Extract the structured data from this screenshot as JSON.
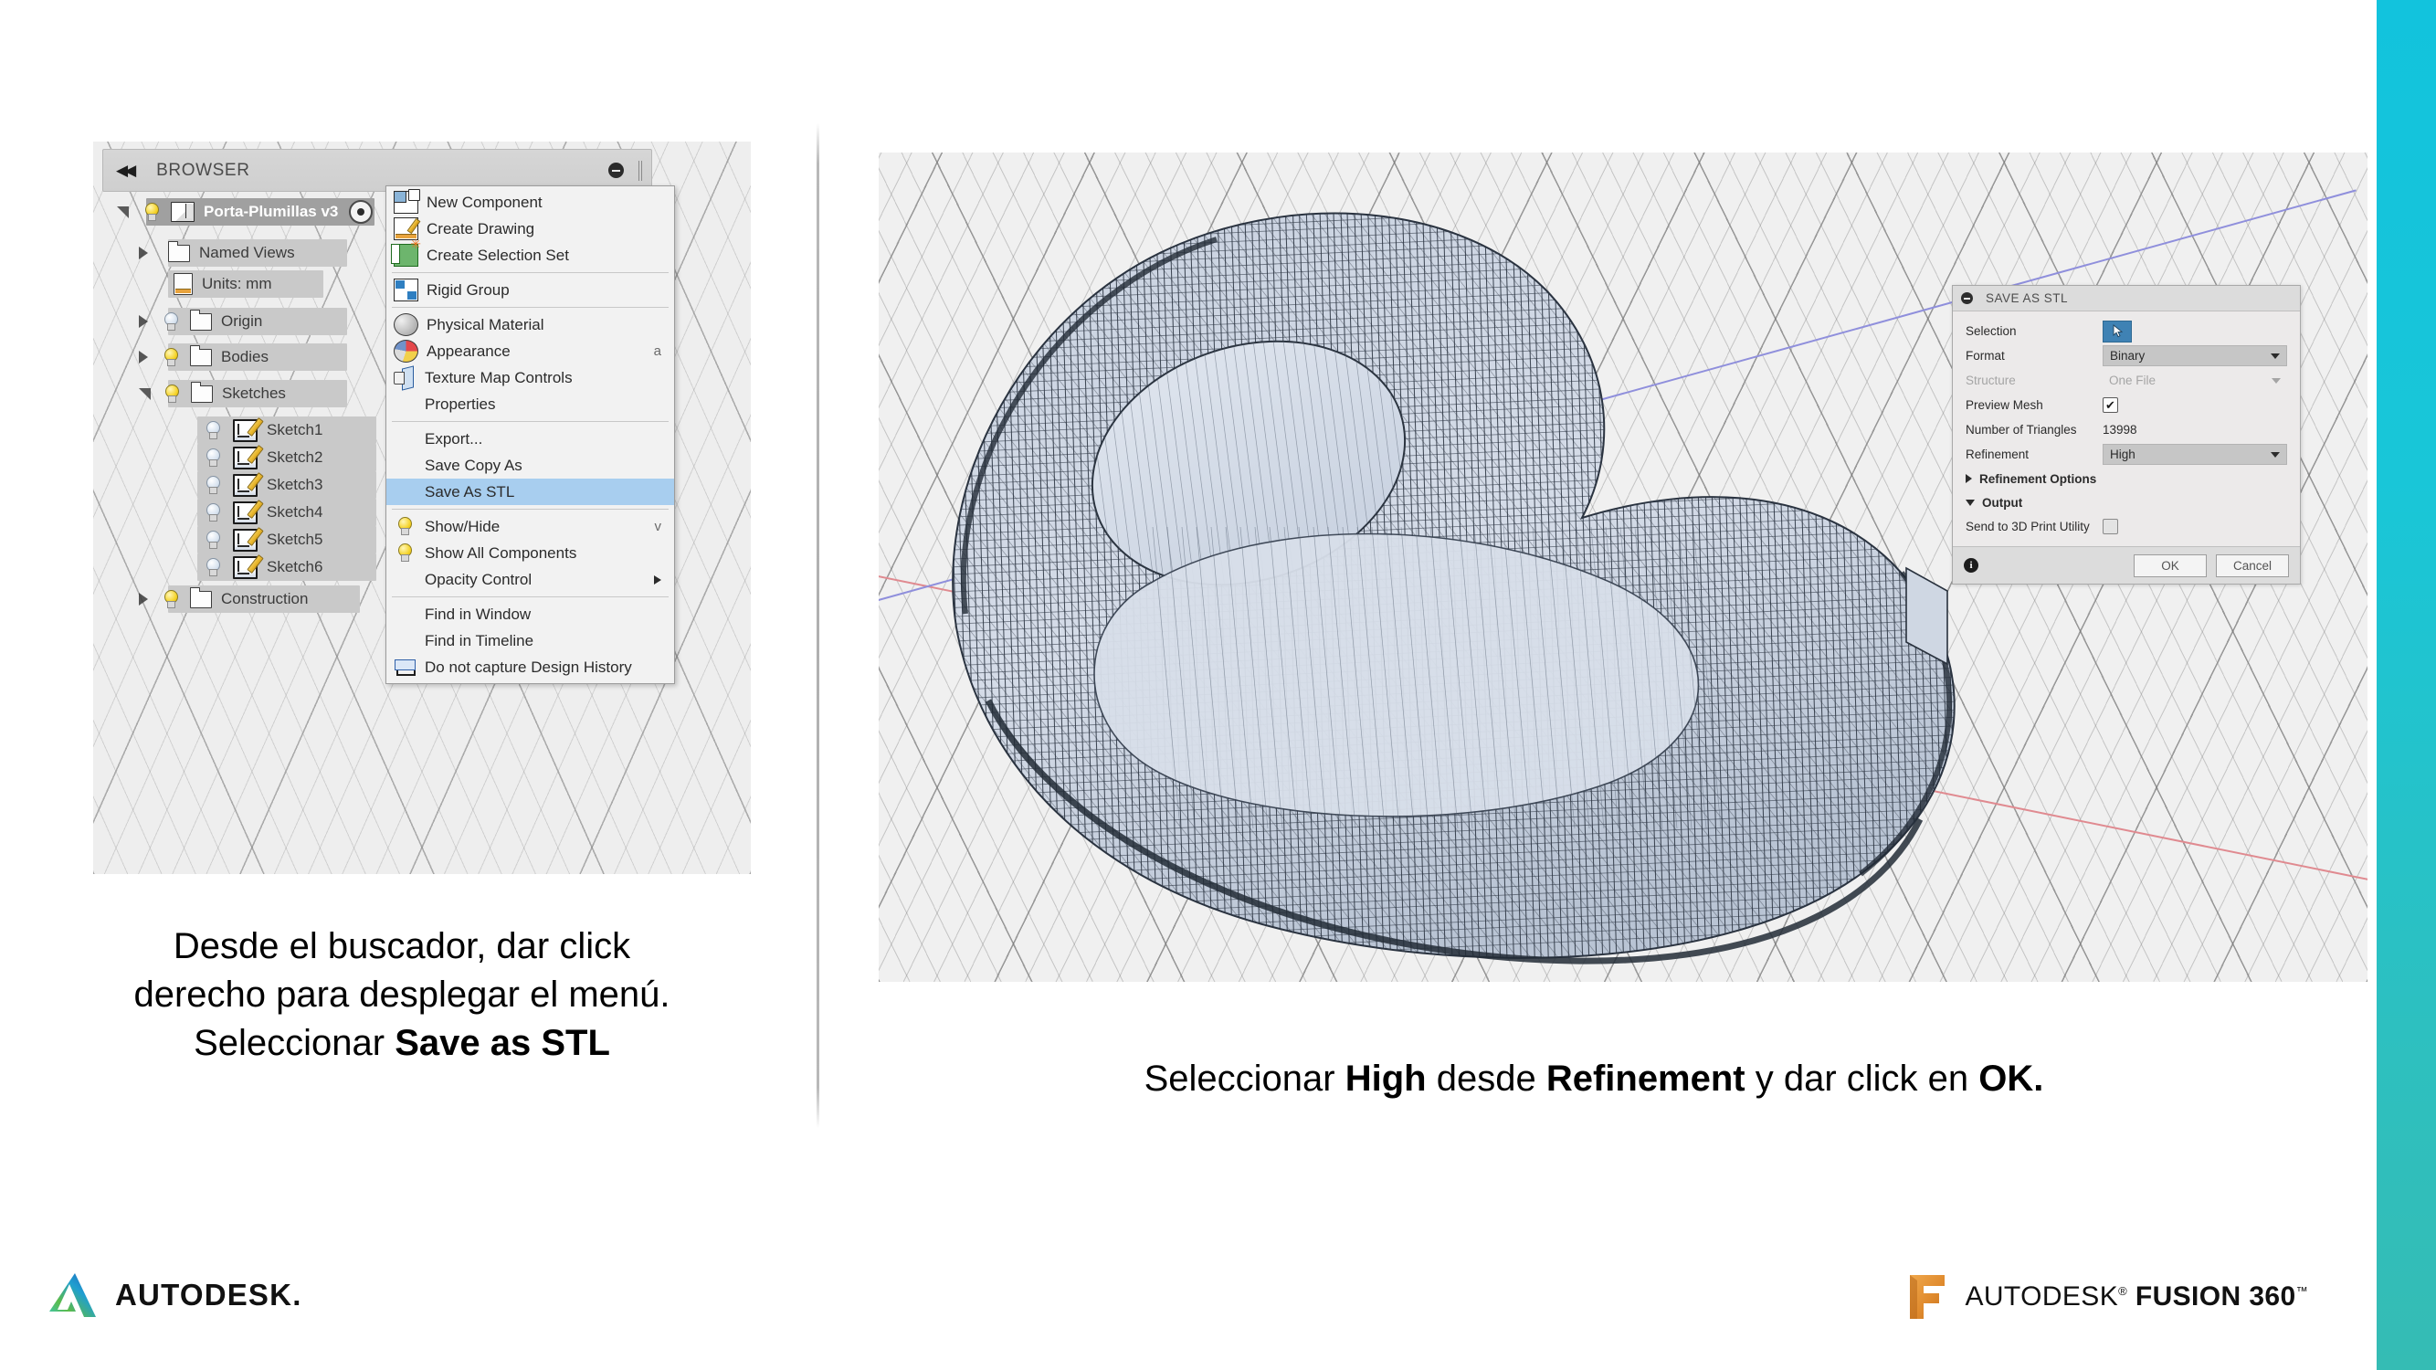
{
  "slide": {
    "accent_color": "#19c6d8"
  },
  "left_screenshot": {
    "browser_panel": {
      "title": "BROWSER",
      "collapse_icon": "double-chevron-left-icon",
      "minimize_icon": "minimize-circle-icon"
    },
    "tree": [
      {
        "label": "Porta-Plumillas v3",
        "icon": "component-cube-icon",
        "selected": true,
        "expanded": true,
        "has_bulb": true,
        "has_eyeball": true
      },
      {
        "label": "Named Views",
        "icon": "folder-icon",
        "expanded": false,
        "has_bulb": false
      },
      {
        "label": "Units: mm",
        "icon": "document-ruler-icon",
        "expanded": null,
        "has_bulb": false
      },
      {
        "label": "Origin",
        "icon": "folder-icon",
        "expanded": false,
        "has_bulb": true,
        "bulb_off": true
      },
      {
        "label": "Bodies",
        "icon": "folder-icon",
        "expanded": false,
        "has_bulb": true
      },
      {
        "label": "Sketches",
        "icon": "folder-icon",
        "expanded": true,
        "has_bulb": true
      },
      {
        "label": "Sketch1",
        "icon": "sketch-icon",
        "has_bulb": true,
        "bulb_off": true,
        "indent": true
      },
      {
        "label": "Sketch2",
        "icon": "sketch-icon",
        "has_bulb": true,
        "bulb_off": true,
        "indent": true
      },
      {
        "label": "Sketch3",
        "icon": "sketch-icon",
        "has_bulb": true,
        "bulb_off": true,
        "indent": true
      },
      {
        "label": "Sketch4",
        "icon": "sketch-icon",
        "has_bulb": true,
        "bulb_off": true,
        "indent": true
      },
      {
        "label": "Sketch5",
        "icon": "sketch-icon",
        "has_bulb": true,
        "bulb_off": true,
        "indent": true
      },
      {
        "label": "Sketch6",
        "icon": "sketch-icon",
        "has_bulb": true,
        "bulb_off": true,
        "indent": true
      },
      {
        "label": "Construction",
        "icon": "folder-icon",
        "expanded": false,
        "has_bulb": true
      }
    ],
    "context_menu": {
      "items": [
        {
          "label": "New Component",
          "icon": "new-component-icon",
          "accel": "",
          "highlighted": false,
          "submenu": false
        },
        {
          "label": "Create Drawing",
          "icon": "create-drawing-icon",
          "accel": "",
          "highlighted": false,
          "submenu": false
        },
        {
          "label": "Create Selection Set",
          "icon": "selection-set-icon",
          "accel": "",
          "highlighted": false,
          "submenu": false
        },
        {
          "separator": true
        },
        {
          "label": "Rigid Group",
          "icon": "rigid-group-icon",
          "accel": "",
          "highlighted": false,
          "submenu": false
        },
        {
          "separator": true
        },
        {
          "label": "Physical Material",
          "icon": "physical-material-icon",
          "accel": "",
          "highlighted": false,
          "submenu": false
        },
        {
          "label": "Appearance",
          "icon": "appearance-icon",
          "accel": "a",
          "highlighted": false,
          "submenu": false
        },
        {
          "label": "Texture Map Controls",
          "icon": "texture-map-icon",
          "accel": "",
          "highlighted": false,
          "submenu": false
        },
        {
          "label": "Properties",
          "icon": "",
          "accel": "",
          "highlighted": false,
          "submenu": false
        },
        {
          "separator": true
        },
        {
          "label": "Export...",
          "icon": "",
          "accel": "",
          "highlighted": false,
          "submenu": false
        },
        {
          "label": "Save Copy As",
          "icon": "",
          "accel": "",
          "highlighted": false,
          "submenu": false
        },
        {
          "label": "Save As STL",
          "icon": "",
          "accel": "",
          "highlighted": true,
          "submenu": false
        },
        {
          "separator": true
        },
        {
          "label": "Show/Hide",
          "icon": "lightbulb-icon",
          "accel": "v",
          "highlighted": false,
          "submenu": false
        },
        {
          "label": "Show All Components",
          "icon": "lightbulb-icon",
          "accel": "",
          "highlighted": false,
          "submenu": false
        },
        {
          "label": "Opacity Control",
          "icon": "",
          "accel": "",
          "highlighted": false,
          "submenu": true
        },
        {
          "separator": true
        },
        {
          "label": "Find in Window",
          "icon": "",
          "accel": "",
          "highlighted": false,
          "submenu": false
        },
        {
          "label": "Find in Timeline",
          "icon": "",
          "accel": "",
          "highlighted": false,
          "submenu": false
        },
        {
          "label": "Do not capture Design History",
          "icon": "no-capture-icon",
          "accel": "",
          "highlighted": false,
          "submenu": false
        }
      ]
    }
  },
  "right_screenshot": {
    "viewport": {
      "model_name": "triangulated-mesh-preview",
      "origin_marker": "origin-point-icon",
      "axis_x_color": "#e08a90",
      "axis_y_color": "#8f8fdc"
    },
    "stl_dialog": {
      "title": "SAVE AS STL",
      "collapse_icon": "minimize-circle-icon",
      "fields": {
        "selection_label": "Selection",
        "selection_icon": "cursor-arrow-icon",
        "format_label": "Format",
        "format_value": "Binary",
        "structure_label": "Structure",
        "structure_value": "One File",
        "preview_mesh_label": "Preview Mesh",
        "preview_mesh_checked": true,
        "triangles_label": "Number of Triangles",
        "triangles_value": "13998",
        "refinement_label": "Refinement",
        "refinement_value": "High",
        "refinement_options_label": "Refinement Options",
        "output_label": "Output",
        "send_3d_label": "Send to 3D Print Utility",
        "send_3d_checked": false
      },
      "footer": {
        "info_icon": "info-icon",
        "ok_label": "OK",
        "cancel_label": "Cancel"
      }
    }
  },
  "captions": {
    "left_line1": "Desde el buscador, dar click",
    "left_line2": "derecho para desplegar el menú.",
    "left_line3_prefix": "Seleccionar ",
    "left_line3_bold": "Save as STL",
    "right_prefix": "Seleccionar ",
    "right_bold1": "High",
    "right_mid1": " desde ",
    "right_bold2": "Refinement",
    "right_mid2": " y dar click en ",
    "right_bold3": "OK."
  },
  "footer": {
    "autodesk_wordmark": "AUTODESK",
    "autodesk_dot": ".",
    "fusion_word_light": "AUTODESK",
    "fusion_reg": "®",
    "fusion_word_heavy": "FUSION 360",
    "fusion_tm": "™"
  }
}
